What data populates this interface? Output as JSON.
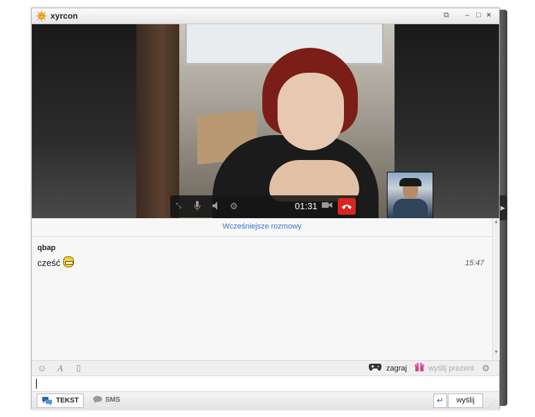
{
  "window": {
    "title": "xyrcon",
    "controls": {
      "restore": "⧉",
      "minimize": "–",
      "maximize": "□",
      "close": "×"
    }
  },
  "call": {
    "timer": "01:31",
    "icons": [
      "fullscreen-icon",
      "microphone-icon",
      "speaker-icon",
      "settings-icon",
      "camera-icon",
      "hangup-icon"
    ]
  },
  "chat": {
    "earlier_link": "Wcześniejsze rozmowy",
    "messages": [
      {
        "sender": "qbap",
        "text": "cześć",
        "time": "15:47",
        "emoticon": "grin-emoticon"
      }
    ]
  },
  "toolbar": {
    "emoji_icon": "☺",
    "font_icon": "A",
    "file_icon": "▯",
    "game_label": "zagraj",
    "gift_label": "wyślij prezent",
    "settings_icon": "⚙"
  },
  "bottombar": {
    "tab_text": "TEKST",
    "tab_sms": "SMS",
    "send_label": "wyślij",
    "enter_icon": "↵"
  },
  "colors": {
    "accent": "#3a74c9",
    "hangup": "#d8261e",
    "titlebar": "#eeeeee"
  }
}
